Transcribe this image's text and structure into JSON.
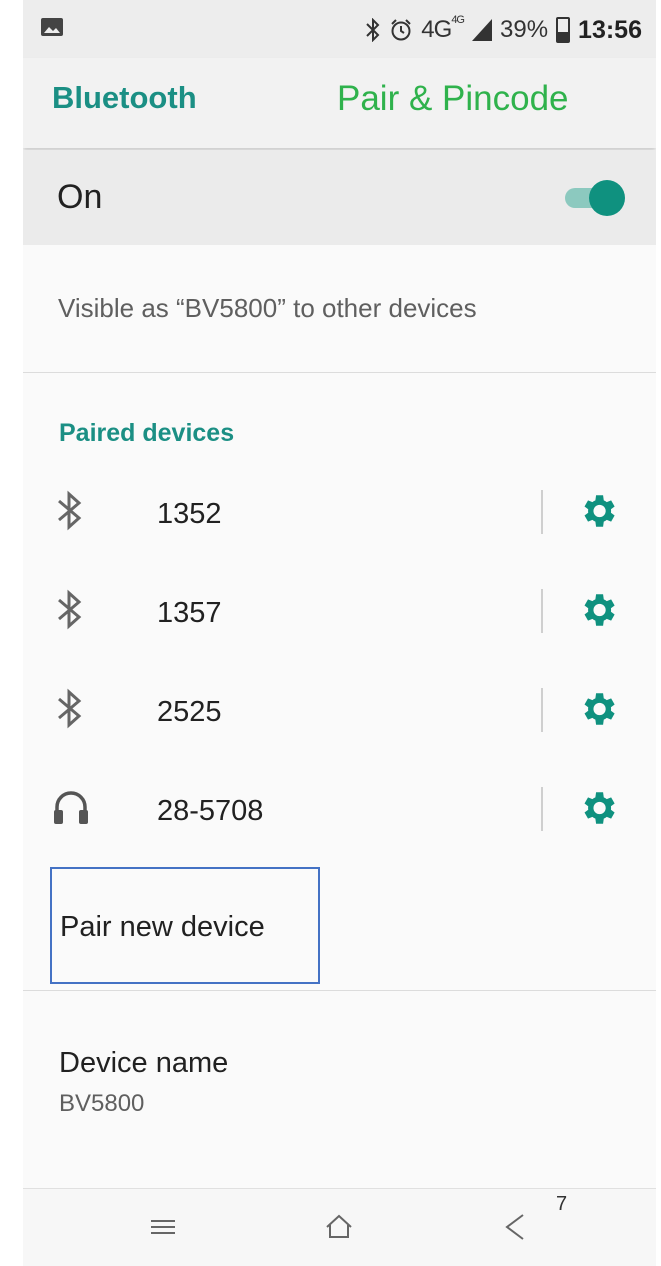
{
  "status_bar": {
    "left_icon": "image-icon",
    "bluetooth_icon": "bluetooth-icon",
    "alarm_icon": "alarm-icon",
    "network": "4G",
    "network_sup": "4G",
    "signal_icon": "signal-icon",
    "battery_percent": "39%",
    "battery_level": 0.39,
    "time": "13:56"
  },
  "app_bar": {
    "title": "Bluetooth",
    "overlay_caption": "Pair & Pincode"
  },
  "master_switch": {
    "label": "On",
    "state": true
  },
  "visibility_text": "Visible as “BV5800” to other devices",
  "paired_section": {
    "header": "Paired devices",
    "devices": [
      {
        "name": "1352",
        "icon": "bluetooth-icon"
      },
      {
        "name": "1357",
        "icon": "bluetooth-icon"
      },
      {
        "name": "2525",
        "icon": "bluetooth-icon"
      },
      {
        "name": "28-5708",
        "icon": "headset-icon"
      }
    ]
  },
  "pair_new_device": {
    "label": "Pair new device"
  },
  "device_name": {
    "title": "Device name",
    "value": "BV5800"
  },
  "nav_bar": {
    "menu_icon": "menu-icon",
    "home_icon": "home-icon",
    "back_icon": "back-icon"
  },
  "page_number": "7",
  "colors": {
    "accent": "#1b8f84",
    "switch_thumb": "#0f917f",
    "switch_track": "#8cc9bf",
    "overlay_caption": "#2fb24c",
    "highlight_box": "#4472c4"
  }
}
